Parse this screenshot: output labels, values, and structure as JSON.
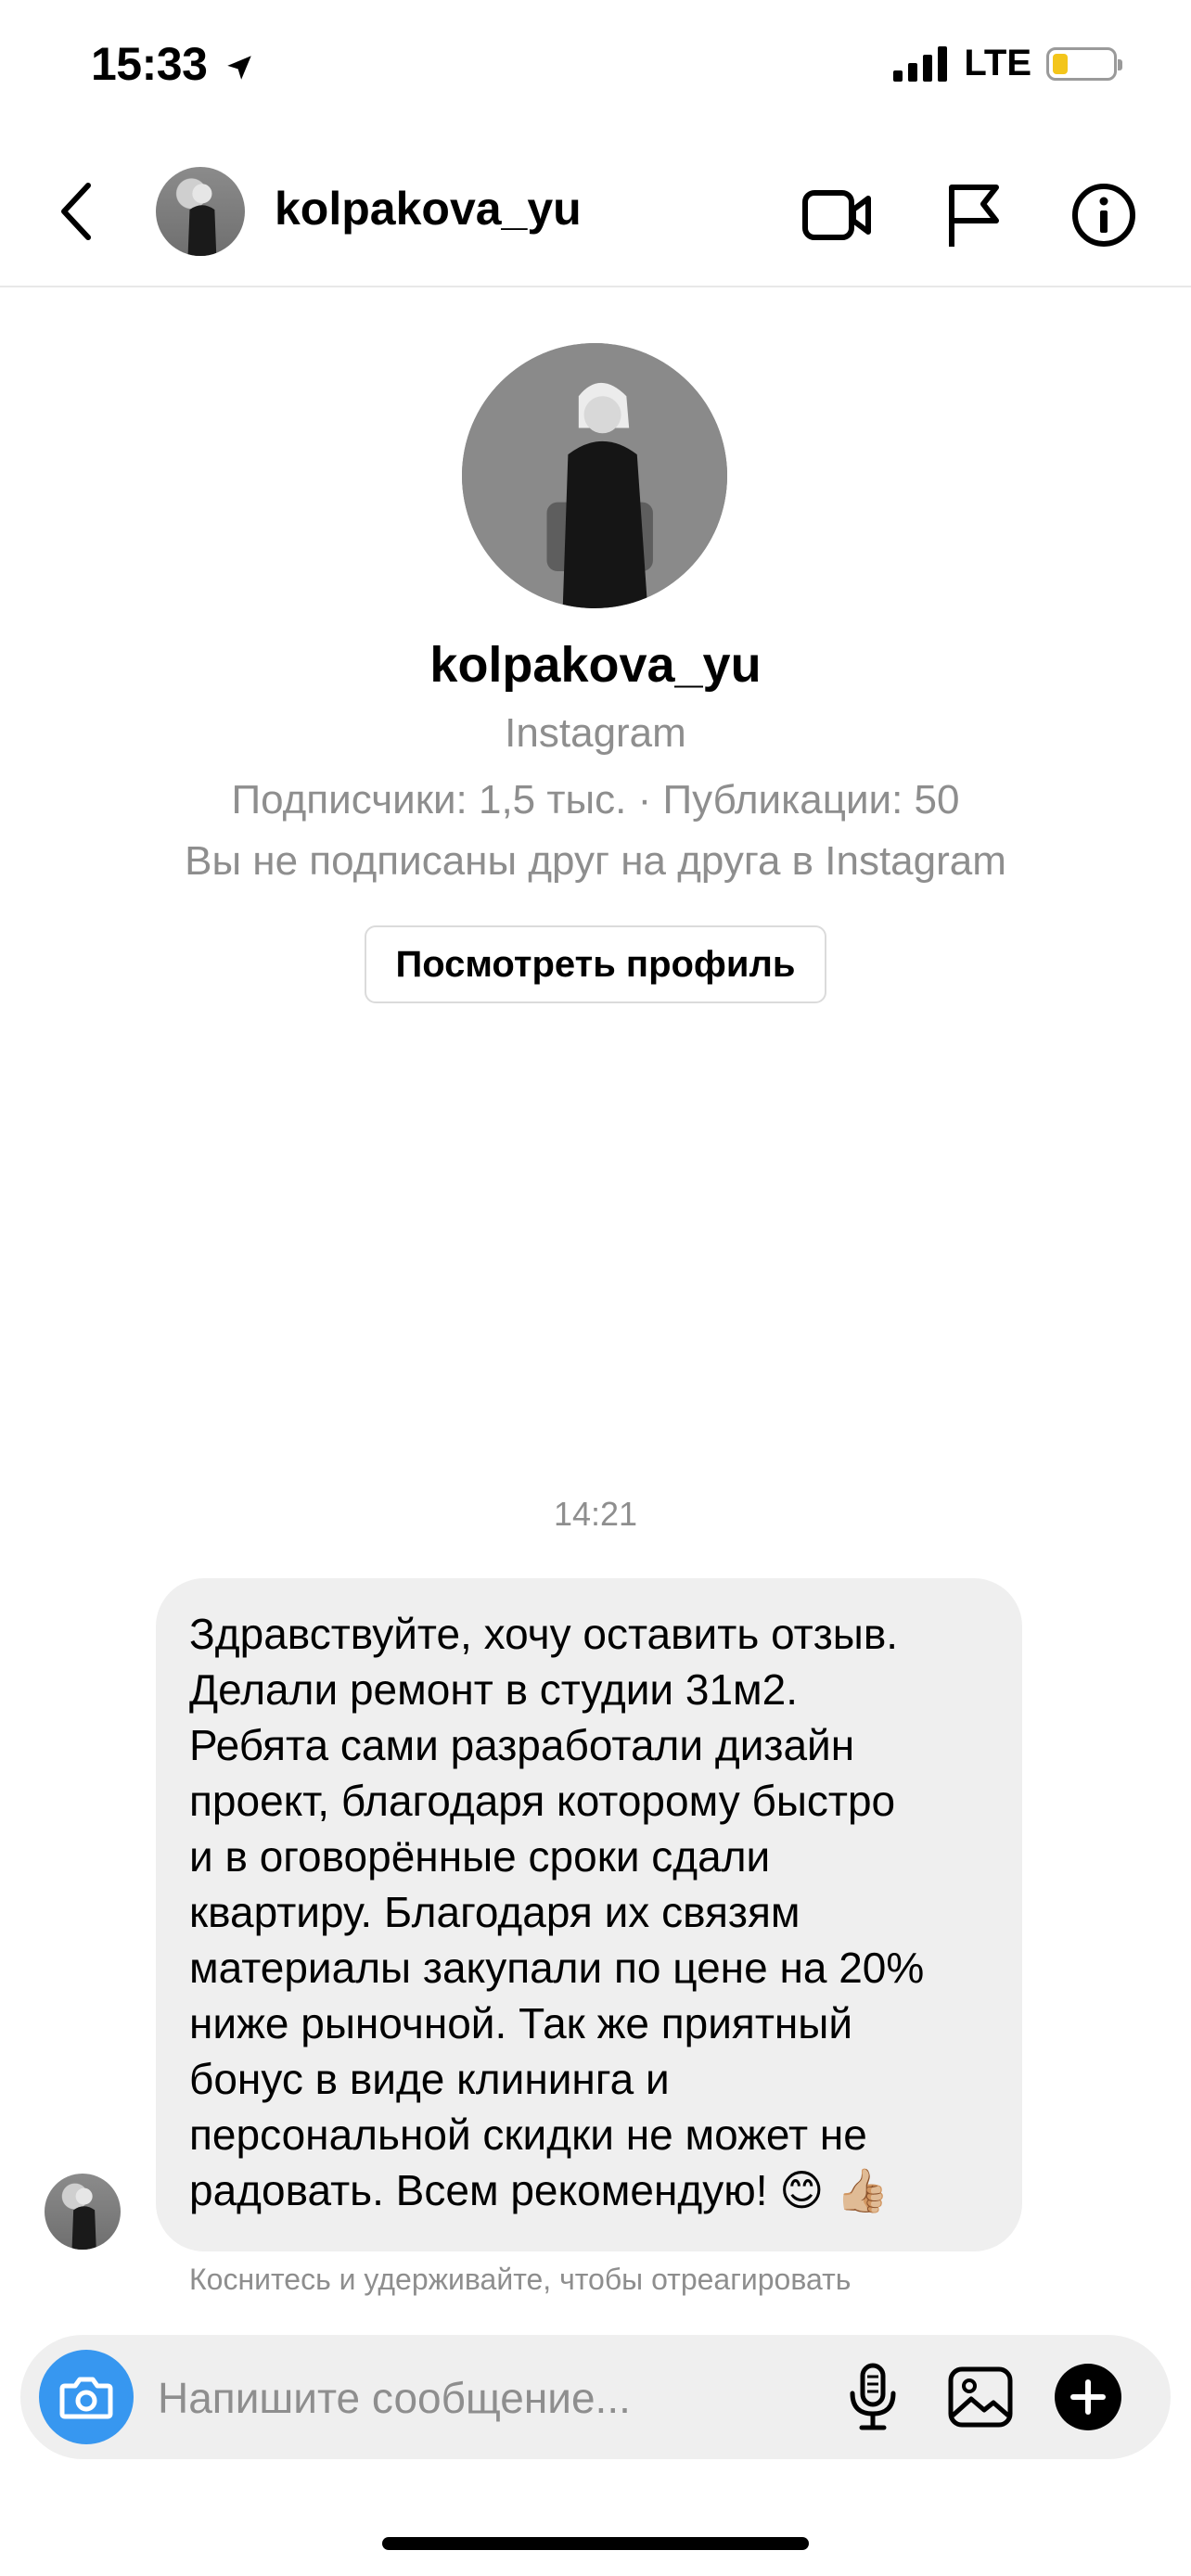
{
  "status_bar": {
    "time": "15:33",
    "network": "LTE",
    "battery_level": 0.25
  },
  "header": {
    "username": "kolpakova_yu"
  },
  "profile": {
    "username": "kolpakova_yu",
    "platform": "Instagram",
    "stats": "Подписчики: 1,5 тыс. · Публикации: 50",
    "follow_status": "Вы не подписаны друг на друга в Instagram",
    "view_profile_label": "Посмотреть профиль"
  },
  "conversation": {
    "timestamp": "14:21",
    "messages": [
      {
        "lines": [
          "Здравствуйте, хочу оставить отзыв.",
          "Делали ремонт в студии 31м2.",
          "Ребята сами разработали дизайн",
          "проект, благодаря которому быстро",
          "и в оговорённые сроки сдали",
          "квартиру. Благодаря их связям",
          "материалы закупали по цене на 20%",
          "ниже рыночной. Так же приятный",
          "бонус в виде клининга и",
          "персональной скидки не может не",
          "радовать. Всем рекомендую! 😊 👍🏼"
        ]
      }
    ],
    "reaction_hint": "Коснитесь и удерживайте, чтобы отреагировать"
  },
  "composer": {
    "placeholder": "Напишите сообщение..."
  },
  "colors": {
    "accent": "#3797f0",
    "bubble": "#efefef",
    "muted_text": "#8e8e8e",
    "battery": "#f3c51b"
  },
  "icons": [
    "location-arrow-icon",
    "signal-icon",
    "battery-icon",
    "back-chevron-icon",
    "video-call-icon",
    "flag-icon",
    "info-icon",
    "camera-icon",
    "microphone-icon",
    "gallery-icon",
    "plus-icon"
  ]
}
